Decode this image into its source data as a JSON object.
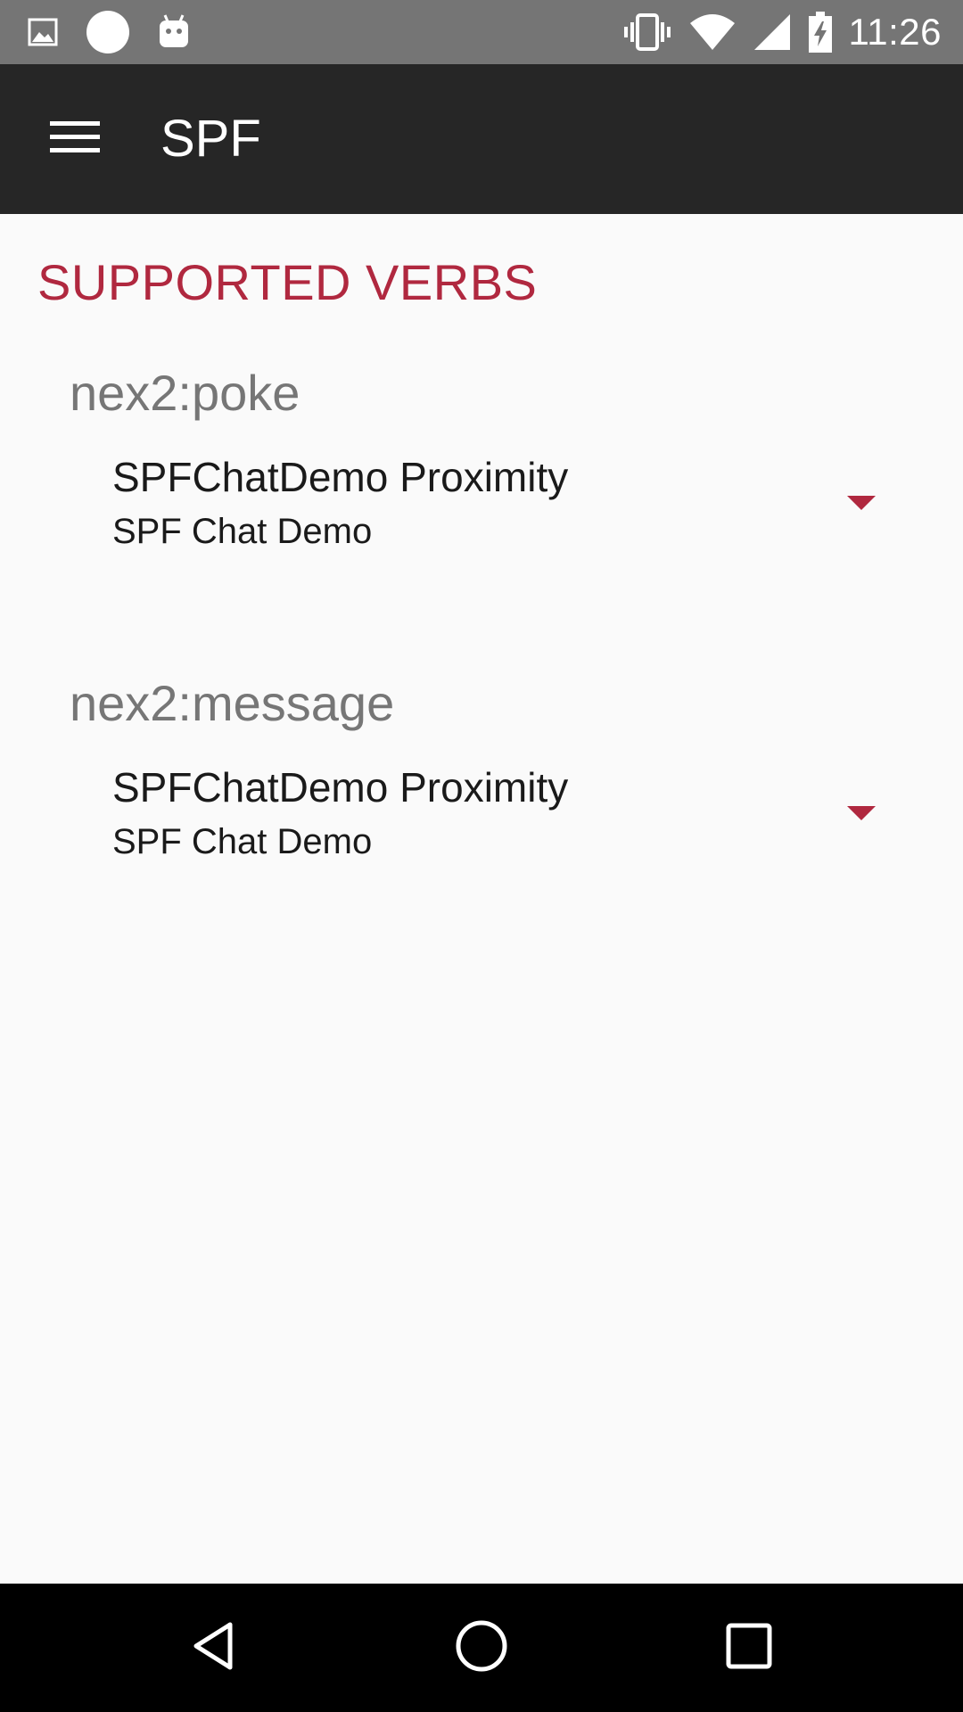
{
  "status_bar": {
    "left_icons": [
      "image-notification-icon",
      "circle-notification-icon",
      "android-notification-icon"
    ],
    "right_icons": [
      "vibrate-icon",
      "wifi-icon",
      "cell-signal-icon",
      "battery-charging-icon"
    ],
    "time": "11:26"
  },
  "app_bar": {
    "menu_icon": "hamburger-menu-icon",
    "title": "SPF"
  },
  "content": {
    "section_title": "SUPPORTED VERBS",
    "verbs": [
      {
        "name": "nex2:poke",
        "selected_primary": "SPFChatDemo Proximity",
        "selected_secondary": "SPF Chat Demo"
      },
      {
        "name": "nex2:message",
        "selected_primary": "SPFChatDemo Proximity",
        "selected_secondary": "SPF Chat Demo"
      }
    ]
  },
  "nav_bar": {
    "buttons": [
      "back-icon",
      "home-icon",
      "recents-icon"
    ]
  },
  "colors": {
    "accent": "#b0283f",
    "status_bar": "#757575",
    "app_bar": "#262626",
    "background": "#fafafa",
    "nav_bar": "#000000"
  }
}
